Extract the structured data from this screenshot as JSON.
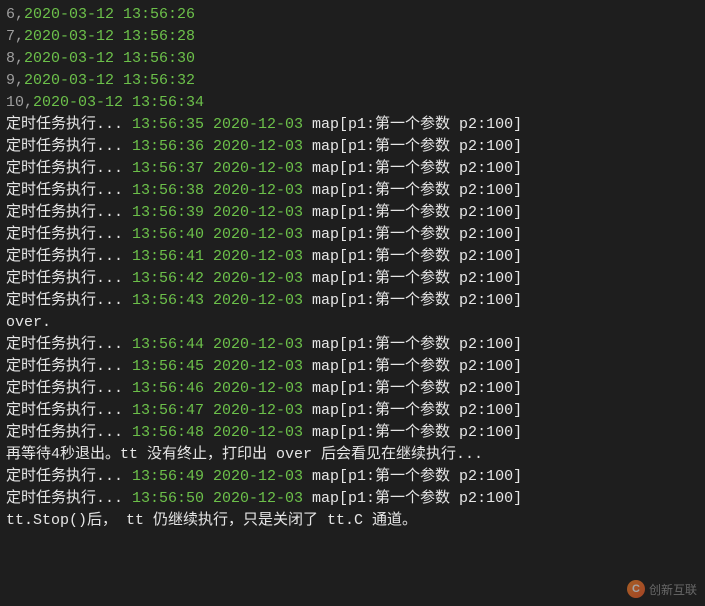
{
  "header_lines": [
    {
      "n": "6",
      "ts": "2020-03-12 13:56:26"
    },
    {
      "n": "7",
      "ts": "2020-03-12 13:56:28"
    },
    {
      "n": "8",
      "ts": "2020-03-12 13:56:30"
    },
    {
      "n": "9",
      "ts": "2020-03-12 13:56:32"
    },
    {
      "n": "10",
      "ts": "2020-03-12 13:56:34"
    }
  ],
  "task_prefix": "定时任务执行... ",
  "map_str": " map[p1:第一个参数 p2:100]",
  "date_str": " 2020-12-03",
  "block1_times": [
    "13:56:35",
    "13:56:36",
    "13:56:37",
    "13:56:38",
    "13:56:39",
    "13:56:40",
    "13:56:41",
    "13:56:42",
    "13:56:43"
  ],
  "over": "over.",
  "block2_times": [
    "13:56:44",
    "13:56:45",
    "13:56:46",
    "13:56:47",
    "13:56:48"
  ],
  "note1": "再等待4秒退出。tt 没有终止，打印出 over 后会看见在继续执行...",
  "block3_times": [
    "13:56:49",
    "13:56:50"
  ],
  "note2": "tt.Stop()后， tt 仍继续执行，只是关闭了 tt.C 通道。",
  "watermarkText": "创新互联"
}
